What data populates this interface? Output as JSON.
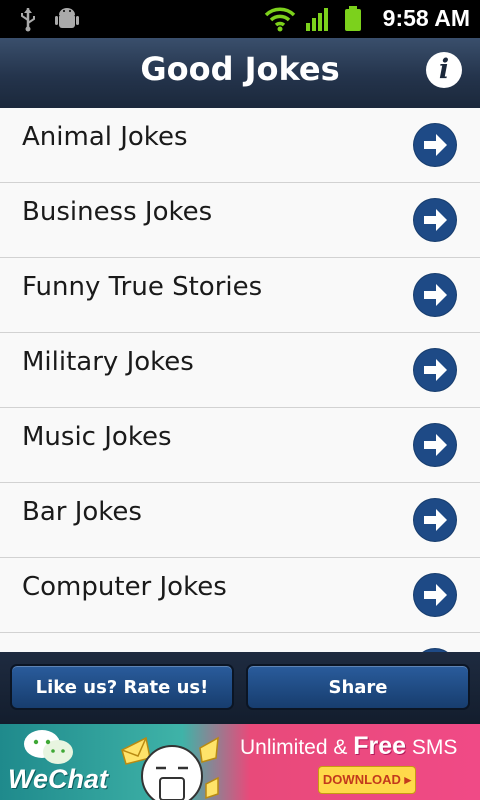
{
  "status_bar": {
    "time": "9:58 AM",
    "icons": [
      "usb-icon",
      "android-debug-icon",
      "wifi-icon",
      "signal-icon",
      "battery-icon"
    ]
  },
  "header": {
    "title": "Good Jokes",
    "info_icon": "info-icon"
  },
  "categories": [
    {
      "label": "Animal Jokes"
    },
    {
      "label": "Business Jokes"
    },
    {
      "label": "Funny True Stories"
    },
    {
      "label": "Military Jokes"
    },
    {
      "label": "Music Jokes"
    },
    {
      "label": "Bar Jokes"
    },
    {
      "label": "Computer Jokes"
    }
  ],
  "buttons": {
    "rate": "Like us? Rate us!",
    "share": "Share"
  },
  "ad": {
    "brand": "WeChat",
    "headline_unlimited": "Unlimited &",
    "headline_free": "Free",
    "headline_sms": "SMS",
    "download": "DOWNLOAD"
  },
  "colors": {
    "header": "#24344c",
    "arrow_circle": "#173d6e",
    "button": "#1e4a86"
  }
}
